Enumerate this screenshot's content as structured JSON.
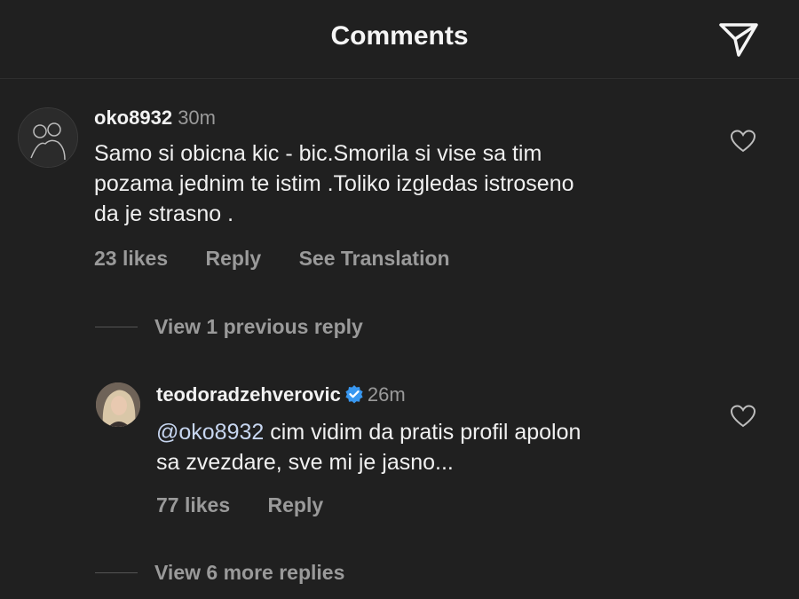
{
  "header": {
    "title": "Comments"
  },
  "comments": [
    {
      "username": "oko8932",
      "time": "30m",
      "text_lines": [
        "Samo si obicna kic - bic.Smorila si vise sa tim",
        "pozama jednim te istim .Toliko izgledas istroseno",
        "da je strasno ."
      ],
      "likes": "23 likes",
      "reply_label": "Reply",
      "translate_label": "See Translation"
    }
  ],
  "view_previous": "View 1 previous reply",
  "reply": {
    "username": "teodoradzehverovic",
    "verified": true,
    "time": "26m",
    "mention": "@oko8932",
    "text_line1": " cim vidim da pratis profil apolon",
    "text_line2": "sa zvezdare, sve mi je jasno...",
    "likes": "77 likes",
    "reply_label": "Reply"
  },
  "view_more": "View 6 more replies",
  "colors": {
    "background": "#202020",
    "secondary_text": "#9a9a9a",
    "verified_badge": "#3897f0"
  },
  "icons": [
    "send-icon",
    "heart-icon",
    "verified-badge-icon"
  ]
}
